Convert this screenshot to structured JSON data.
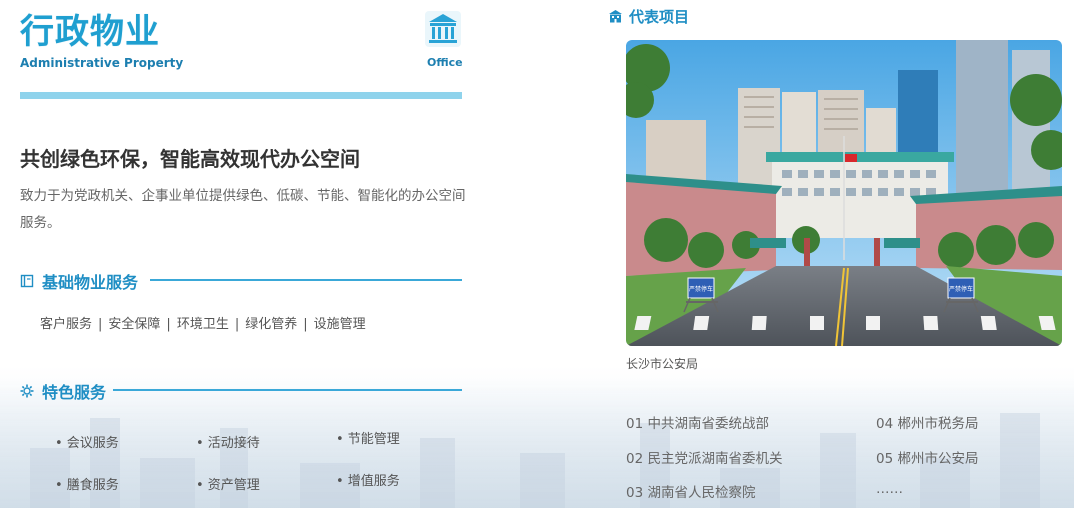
{
  "header": {
    "title_cn": "行政物业",
    "title_en": "Administrative Property",
    "office_label": "Office",
    "office_icon": "building-icon"
  },
  "headline": "共创绿色环保，智能高效现代办公空间",
  "intro": "致力于为党政机关、企事业单位提供绿色、低碳、节能、智能化的办公空间服务。",
  "basic_services": {
    "title": "基础物业服务",
    "icon": "book-icon",
    "items": [
      "客户服务",
      "安全保障",
      "环境卫生",
      "绿化管养",
      "设施管理"
    ]
  },
  "featured_services": {
    "title": "特色服务",
    "icon": "gear-icon",
    "items": [
      "• 会议服务",
      "• 活动接待",
      "• 节能管理",
      "• 膳食服务",
      "• 资产管理",
      "• 增值服务"
    ]
  },
  "projects": {
    "title": "代表项目",
    "icon": "building-icon",
    "photo_caption": "长沙市公安局",
    "photo_sign_left": "严禁停车",
    "photo_sign_right": "严禁停车",
    "items": [
      "01  中共湖南省委统战部",
      "02  民主党派湖南省委机关",
      "03  湖南省人民检察院",
      "04  郴州市税务局",
      "05  郴州市公安局",
      "……"
    ]
  },
  "colors": {
    "accent": "#1f9fd0",
    "accent_dark": "#1d7fb0",
    "bar": "#8fd3ec"
  }
}
